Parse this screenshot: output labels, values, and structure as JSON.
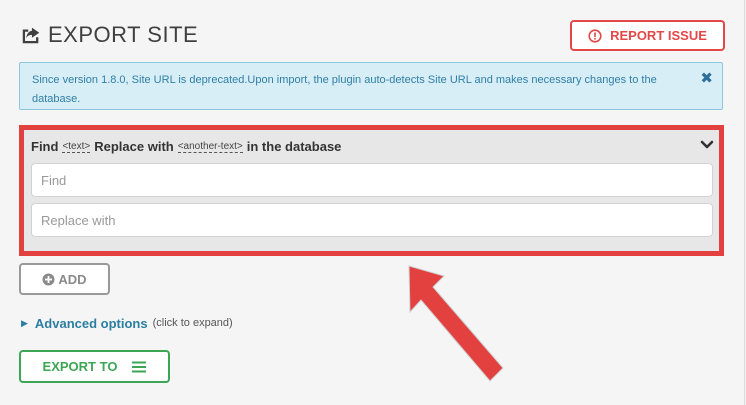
{
  "header": {
    "title": "EXPORT SITE",
    "icon": "export-share-icon"
  },
  "report_button": {
    "label": "REPORT ISSUE",
    "icon": "exclamation-circle-icon",
    "color": "#e34848"
  },
  "notice": {
    "text": "Since version 1.8.0, Site URL is deprecated.Upon import, the plugin auto-detects Site URL and makes necessary changes to the database.",
    "close_glyph": "✖",
    "background": "#d8eef7"
  },
  "find_replace": {
    "find_label": "Find",
    "find_tag": "<text>",
    "replace_label": "Replace with",
    "replace_tag": "<another-text>",
    "suffix": "in the database",
    "find_placeholder": "Find",
    "find_value": "",
    "replace_placeholder": "Replace with",
    "replace_value": "",
    "highlight_color": "#e34040",
    "chevron_icon": "chevron-down-icon"
  },
  "add_button": {
    "label": "ADD",
    "icon": "plus-circle-icon"
  },
  "advanced": {
    "label": "Advanced options",
    "hint": "(click to expand)"
  },
  "export_button": {
    "label": "EXPORT TO",
    "icon": "hamburger-menu-icon",
    "color": "#3ca655"
  },
  "annotation": {
    "icon": "red-arrow-icon",
    "color": "#e34040"
  }
}
